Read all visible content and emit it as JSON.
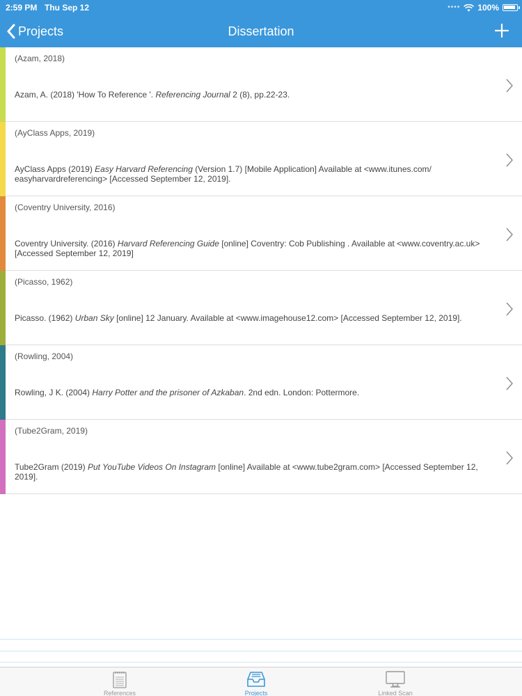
{
  "status_bar": {
    "time": "2:59 PM",
    "date": "Thu Sep 12",
    "battery": "100%",
    "battery_level": 1.0
  },
  "nav": {
    "back_label": "Projects",
    "title": "Dissertation",
    "add_icon": "plus-icon",
    "back_icon": "chevron-left-icon"
  },
  "colors": {
    "header": "#3a97db",
    "tab_active": "#3a97db",
    "tab_inactive": "#999999"
  },
  "references": [
    {
      "key": "(Azam, 2018)",
      "color": "#c7dd4f",
      "parts": [
        {
          "text": "Azam, A. (2018) 'How To Reference '. "
        },
        {
          "text": "Referencing Journal",
          "italic": true
        },
        {
          "text": " 2 (8), pp.22-23."
        }
      ]
    },
    {
      "key": "(AyClass Apps, 2019)",
      "color": "#f4d94b",
      "parts": [
        {
          "text": "AyClass Apps (2019) "
        },
        {
          "text": "Easy Harvard Referencing",
          "italic": true
        },
        {
          "text": " (Version 1.7) [Mobile Application] Available at <www.itunes.com/ easyharvardreferencing> [Accessed September 12, 2019]."
        }
      ]
    },
    {
      "key": "(Coventry University, 2016)",
      "color": "#e2893e",
      "parts": [
        {
          "text": "Coventry University. (2016) "
        },
        {
          "text": "Harvard Referencing Guide",
          "italic": true
        },
        {
          "text": " [online] Coventry: Cob Publishing . Available at <www.coventry.ac.uk> [Accessed September 12, 2019]"
        }
      ]
    },
    {
      "key": "(Picasso, 1962)",
      "color": "#9eae3a",
      "parts": [
        {
          "text": "Picasso. (1962) "
        },
        {
          "text": "Urban Sky",
          "italic": true
        },
        {
          "text": " [online] 12 January. Available at <www.imagehouse12.com> [Accessed September 12, 2019]."
        }
      ]
    },
    {
      "key": "(Rowling, 2004)",
      "color": "#2e7b8a",
      "parts": [
        {
          "text": "Rowling, J K. (2004) "
        },
        {
          "text": "Harry Potter and the prisoner of Azkaban",
          "italic": true
        },
        {
          "text": ". 2nd edn. London: Pottermore."
        }
      ]
    },
    {
      "key": "(Tube2Gram, 2019)",
      "color": "#d36fbf",
      "parts": [
        {
          "text": "Tube2Gram (2019) "
        },
        {
          "text": "Put YouTube Videos On Instagram",
          "italic": true
        },
        {
          "text": " [online] Available at <www.tube2gram.com> [Accessed September 12, 2019]."
        }
      ]
    }
  ],
  "tabs": [
    {
      "label": "References",
      "icon": "notepad-icon",
      "active": false
    },
    {
      "label": "Projects",
      "icon": "inbox-tray-icon",
      "active": true
    },
    {
      "label": "Linked Scan",
      "icon": "monitor-icon",
      "active": false
    }
  ]
}
